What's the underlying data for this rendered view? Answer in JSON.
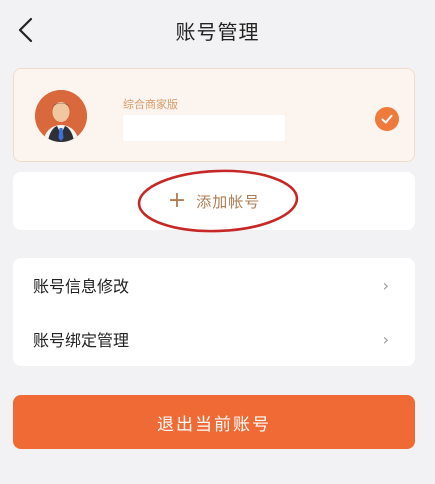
{
  "header": {
    "title": "账号管理",
    "back_icon": "chevron-left-icon"
  },
  "current_account": {
    "edition": "综合商家版",
    "avatar_icon": "person-avatar",
    "selected": true,
    "check_icon": "check-icon"
  },
  "add_account": {
    "icon": "plus-icon",
    "plus_glyph": "+",
    "label": "添加帐号"
  },
  "settings": {
    "items": [
      {
        "label": "账号信息修改",
        "chevron": "›"
      },
      {
        "label": "账号绑定管理",
        "chevron": "›"
      }
    ]
  },
  "logout": {
    "label": "退出当前账号"
  },
  "colors": {
    "accent": "#ef6a34",
    "check": "#ee7a3b",
    "add_text": "#b07c52",
    "highlight": "#c62828",
    "background": "#f2f2f4"
  }
}
